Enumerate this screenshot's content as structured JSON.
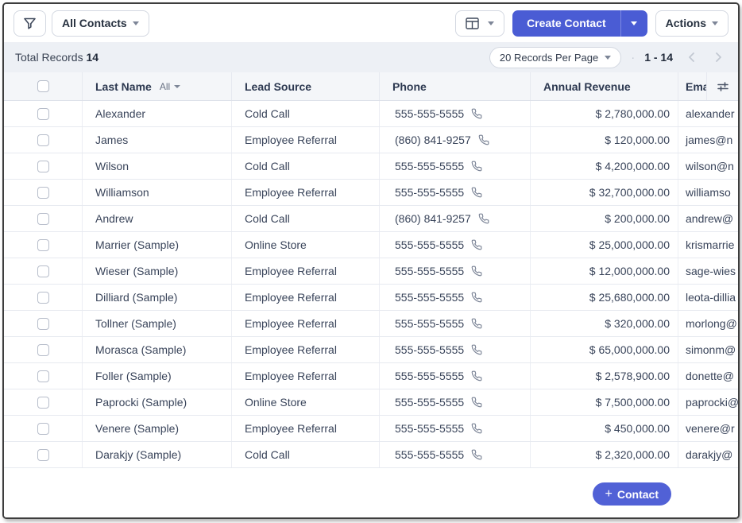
{
  "toolbar": {
    "filter_icon": "funnel-icon",
    "view_selector_label": "All Contacts",
    "layout_icon": "table-view-icon",
    "create_label": "Create Contact",
    "actions_label": "Actions"
  },
  "records_bar": {
    "total_label": "Total Records",
    "total_count": "14",
    "per_page_label": "20 Records Per Page",
    "separator": "·",
    "range_label": "1 - 14"
  },
  "table": {
    "headers": {
      "last_name": "Last Name",
      "lead_source": "Lead Source",
      "phone": "Phone",
      "annual_revenue": "Annual Revenue",
      "email": "Ema"
    },
    "last_name_filter": "All",
    "column_settings_icon": "column-sliders-icon",
    "rows": [
      {
        "last_name": "Alexander",
        "lead_source": "Cold Call",
        "phone": "555-555-5555",
        "annual_revenue": "$ 2,780,000.00",
        "email": "alexander"
      },
      {
        "last_name": "James",
        "lead_source": "Employee Referral",
        "phone": "(860) 841-9257",
        "annual_revenue": "$ 120,000.00",
        "email": "james@n"
      },
      {
        "last_name": "Wilson",
        "lead_source": "Cold Call",
        "phone": "555-555-5555",
        "annual_revenue": "$ 4,200,000.00",
        "email": "wilson@n"
      },
      {
        "last_name": "Williamson",
        "lead_source": "Employee Referral",
        "phone": "555-555-5555",
        "annual_revenue": "$ 32,700,000.00",
        "email": "williamso"
      },
      {
        "last_name": "Andrew",
        "lead_source": "Cold Call",
        "phone": "(860) 841-9257",
        "annual_revenue": "$ 200,000.00",
        "email": "andrew@"
      },
      {
        "last_name": "Marrier (Sample)",
        "lead_source": "Online Store",
        "phone": "555-555-5555",
        "annual_revenue": "$ 25,000,000.00",
        "email": "krismarrie"
      },
      {
        "last_name": "Wieser (Sample)",
        "lead_source": "Employee Referral",
        "phone": "555-555-5555",
        "annual_revenue": "$ 12,000,000.00",
        "email": "sage-wies"
      },
      {
        "last_name": "Dilliard (Sample)",
        "lead_source": "Employee Referral",
        "phone": "555-555-5555",
        "annual_revenue": "$ 25,680,000.00",
        "email": "leota-dillia"
      },
      {
        "last_name": "Tollner (Sample)",
        "lead_source": "Employee Referral",
        "phone": "555-555-5555",
        "annual_revenue": "$ 320,000.00",
        "email": "morlong@"
      },
      {
        "last_name": "Morasca (Sample)",
        "lead_source": "Employee Referral",
        "phone": "555-555-5555",
        "annual_revenue": "$ 65,000,000.00",
        "email": "simonm@"
      },
      {
        "last_name": "Foller (Sample)",
        "lead_source": "Employee Referral",
        "phone": "555-555-5555",
        "annual_revenue": "$ 2,578,900.00",
        "email": "donette@"
      },
      {
        "last_name": "Paprocki (Sample)",
        "lead_source": "Online Store",
        "phone": "555-555-5555",
        "annual_revenue": "$ 7,500,000.00",
        "email": "paprocki@"
      },
      {
        "last_name": "Venere (Sample)",
        "lead_source": "Employee Referral",
        "phone": "555-555-5555",
        "annual_revenue": "$ 450,000.00",
        "email": "venere@r"
      },
      {
        "last_name": "Darakjy (Sample)",
        "lead_source": "Cold Call",
        "phone": "555-555-5555",
        "annual_revenue": "$ 2,320,000.00",
        "email": "darakjy@"
      }
    ]
  },
  "footer": {
    "plus": "+",
    "contact_label": "Contact"
  },
  "colors": {
    "accent_blue": "#4a5cd4",
    "pill_blue": "#5161d6",
    "bar_background": "#edf0f5",
    "header_background": "#f4f6f9",
    "row_border": "#e7eaf0",
    "text": "#39445a"
  }
}
